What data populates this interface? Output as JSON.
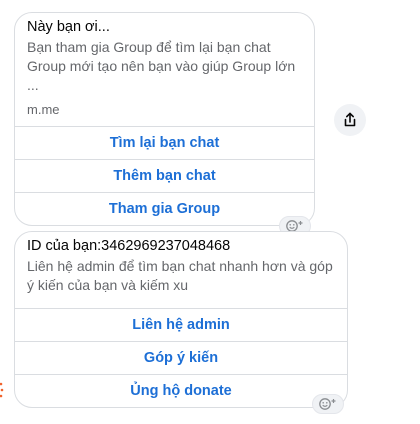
{
  "messages": [
    {
      "title": "Này bạn ơi...",
      "description": "Bạn tham gia Group để tìm lại bạn chat Group mới tạo nên bạn vào giúp Group lớn ...",
      "link": "m.me",
      "buttons": [
        "Tìm lại bạn chat",
        "Thêm bạn chat",
        "Tham gia Group"
      ]
    },
    {
      "title": "ID của bạn:3462969237048468",
      "description": "Liên hệ admin để tìm bạn chat nhanh hơn và góp ý kiến của bạn và kiếm xu",
      "buttons": [
        "Liên hệ admin",
        "Góp ý kiến",
        "Ủng hộ donate"
      ]
    }
  ],
  "icons": {
    "share": "share-icon",
    "react": "smiley-plus-icon"
  },
  "colors": {
    "button_text": "#1d6fd6",
    "secondary_text": "#65676b",
    "border": "#dadde1",
    "accent_mark": "#f0642e"
  }
}
